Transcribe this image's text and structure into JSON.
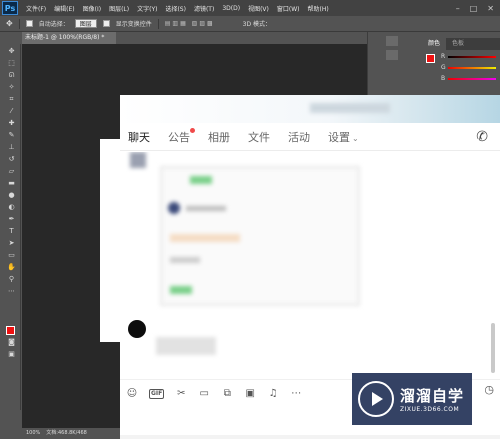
{
  "app": {
    "logo": "Ps",
    "menu": [
      "文件(F)",
      "编辑(E)",
      "图像(I)",
      "图层(L)",
      "文字(Y)",
      "选择(S)",
      "滤镜(T)",
      "3D(D)",
      "视图(V)",
      "窗口(W)",
      "帮助(H)"
    ],
    "window_controls": [
      "–",
      "□",
      "✕"
    ]
  },
  "options_bar": {
    "auto_select_label": "自动选择：",
    "auto_select_value": "图层",
    "show_transform_label": "显示变换控件",
    "mode_3d_label": "3D 模式："
  },
  "document": {
    "tab_label": "未标题-1 @ 100%(RGB/8) *",
    "zoom": "100%",
    "doc_info": "文档:468.8K/468"
  },
  "panels": {
    "tabs": [
      "颜色",
      "色板"
    ],
    "active_tab": 0,
    "slider_letters": [
      "R",
      "G",
      "B"
    ]
  },
  "colors": {
    "foreground": "#e11111",
    "background": "#ffffff"
  },
  "chat": {
    "tabs": [
      {
        "label": "聊天",
        "active": true,
        "badge": false
      },
      {
        "label": "公告",
        "active": false,
        "badge": true
      },
      {
        "label": "相册",
        "active": false,
        "badge": false
      },
      {
        "label": "文件",
        "active": false,
        "badge": false
      },
      {
        "label": "活动",
        "active": false,
        "badge": false
      },
      {
        "label": "设置",
        "active": false,
        "badge": false,
        "dropdown": true
      }
    ],
    "gif_label": "GIF",
    "toolbar_icons": [
      "emoji-icon",
      "gif-icon",
      "scissors-icon",
      "folder-icon",
      "image-collection-icon",
      "picture-icon",
      "bell-icon",
      "more-icon"
    ]
  },
  "watermark": {
    "name": "溜溜自学",
    "url": "ZIXUE.3D66.COM"
  }
}
